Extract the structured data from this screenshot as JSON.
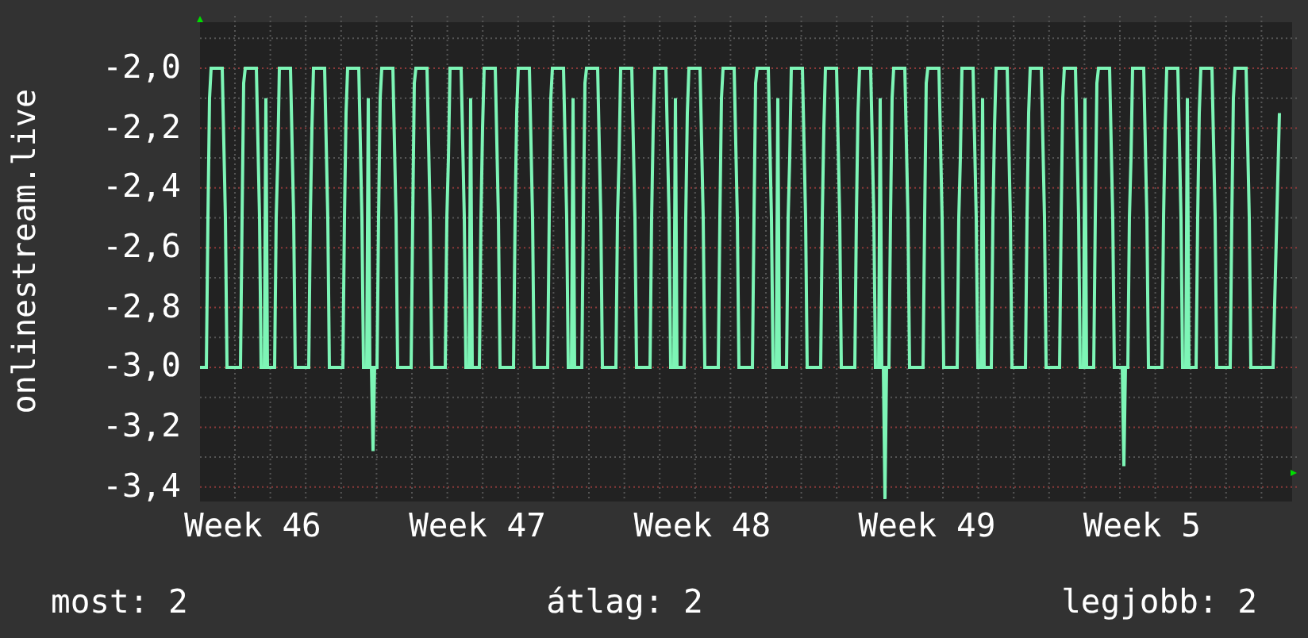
{
  "graph": {
    "y_axis_title": "onlinestream.live",
    "y_tick_labels": [
      "-2,0",
      "-2,2",
      "-2,4",
      "-2,6",
      "-2,8",
      "-3,0",
      "-3,2",
      "-3,4"
    ],
    "x_tick_labels": [
      "Week 46",
      "Week 47",
      "Week 48",
      "Week 49",
      "Week 5"
    ]
  },
  "summary": [
    "most: 2",
    "átlag: 2",
    "legjobb: 2"
  ]
}
